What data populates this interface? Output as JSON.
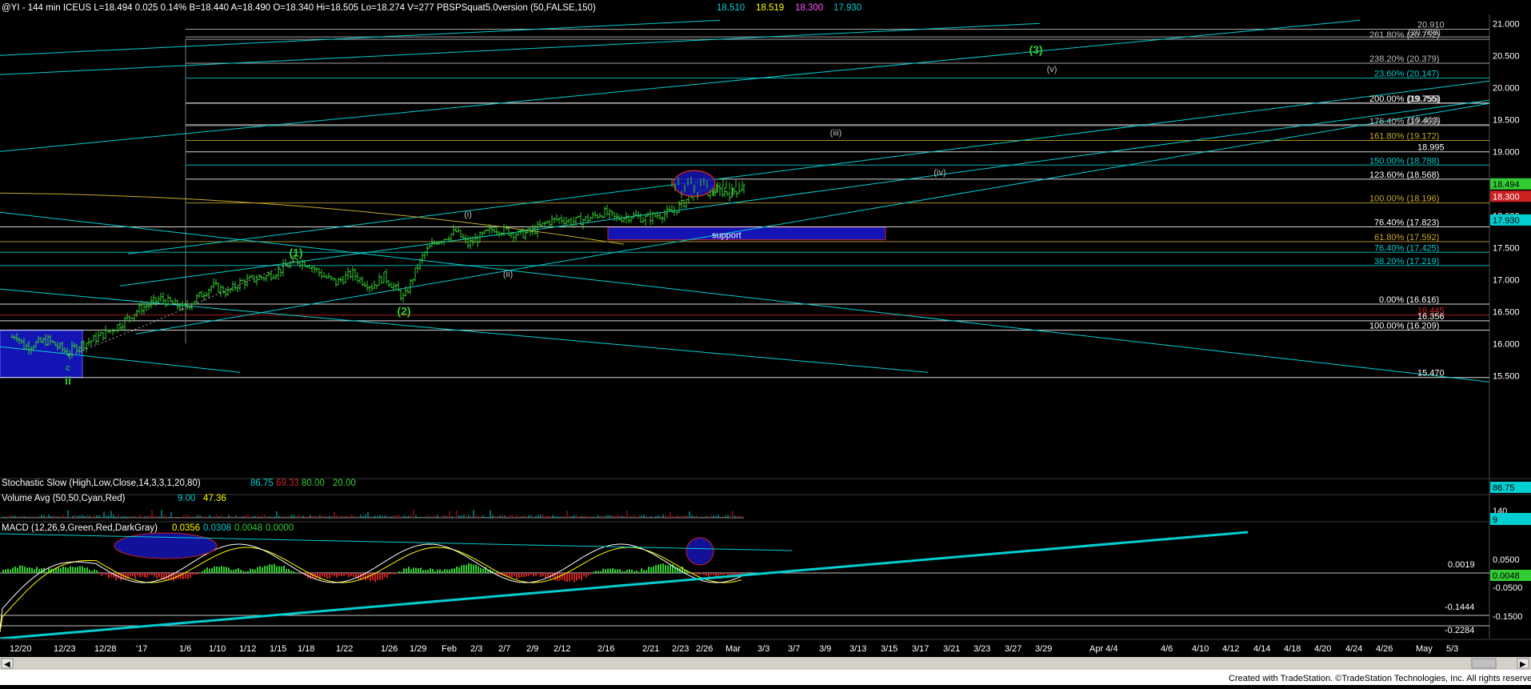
{
  "header": {
    "symbol_line": "@YI - 144 min  ICEUS  L=18.494  0.025  0.14%  B=18.440  A=18.490  O=18.340  Hi=18.505  Lo=18.274  V=277  PBSPSquat5.0version (50,FALSE,150)",
    "v1": "18.510",
    "v2": "18.519",
    "v3": "18.300",
    "v4": "17.930"
  },
  "colors": {
    "bg": "#000000",
    "cyan": "#00CED1",
    "green": "#33CC33",
    "red": "#CC2222",
    "blue": "#1414B4",
    "gold": "#C8A82A",
    "white": "#FFFFFF",
    "grey": "#BFBFBF",
    "yellow": "#FFFF00",
    "axis": "#505050"
  },
  "price_axis": [
    "21.000",
    "20.500",
    "20.000",
    "19.500",
    "19.000",
    "18.500",
    "18.000",
    "17.500",
    "17.000",
    "16.500",
    "16.000",
    "15.500"
  ],
  "levels": [
    {
      "label": "20.910",
      "price": 20.91,
      "color": "#BFBFBF"
    },
    {
      "label": "261.80% (20.752)",
      "price": 20.752,
      "color": "#BFBFBF"
    },
    {
      "label": "(20.788)",
      "price": 20.79,
      "color": "#BFBFBF"
    },
    {
      "label": "238.20% (20.379)",
      "price": 20.379,
      "color": "#BFBFBF"
    },
    {
      "label": "23.60% (20.147)",
      "price": 20.147,
      "color": "#00CED1"
    },
    {
      "label": "200.00% (19.755)",
      "price": 19.755,
      "color": "#FFFFFF"
    },
    {
      "label": "(19.755)",
      "price": 19.755,
      "color": "#FFFFFF"
    },
    {
      "label": "176.40% (19.403)",
      "price": 19.403,
      "color": "#BFBFBF"
    },
    {
      "label": "(19.403)",
      "price": 19.42,
      "color": "#BFBFBF"
    },
    {
      "label": "161.80% (19.172)",
      "price": 19.172,
      "color": "#C8A82A"
    },
    {
      "label": "18.995",
      "price": 18.995,
      "color": "#FFFFFF"
    },
    {
      "label": "150.00% (18.788)",
      "price": 18.788,
      "color": "#00CED1"
    },
    {
      "label": "123.60% (18.568)",
      "price": 18.568,
      "color": "#FFFFFF"
    },
    {
      "label": "100.00% (18.196)",
      "price": 18.196,
      "color": "#C8A82A"
    },
    {
      "label": "76.40% (17.823)",
      "price": 17.823,
      "color": "#FFFFFF"
    },
    {
      "label": "61.80% (17.592)",
      "price": 17.592,
      "color": "#C8A82A"
    },
    {
      "label": "76.40% (17.425)",
      "price": 17.425,
      "color": "#00CED1"
    },
    {
      "label": "38.20% (17.219)",
      "price": 17.219,
      "color": "#00CED1"
    },
    {
      "label": "0.00% (16.616)",
      "price": 16.616,
      "color": "#FFFFFF"
    },
    {
      "label": "16.445",
      "price": 16.445,
      "color": "#CC2222"
    },
    {
      "label": "16.356",
      "price": 16.356,
      "color": "#FFFFFF"
    },
    {
      "label": "100.00% (16.209)",
      "price": 16.209,
      "color": "#FFFFFF"
    },
    {
      "label": "15.470",
      "price": 15.47,
      "color": "#FFFFFF"
    }
  ],
  "price_badges": [
    {
      "label": "18.494",
      "price": 18.494,
      "bg": "#33CC33",
      "fg": "#000000"
    },
    {
      "label": "18.300",
      "price": 18.3,
      "bg": "#CC2222",
      "fg": "#FFFFFF"
    },
    {
      "label": "17.930",
      "price": 17.93,
      "bg": "#00CED1",
      "fg": "#000000"
    }
  ],
  "wave_labels": [
    {
      "text": "(3)",
      "date": "Mar 28",
      "price": 20.53,
      "color": "#33CC33",
      "bold": true
    },
    {
      "text": "(v)",
      "date": "Mar 29",
      "price": 20.24,
      "color": "#BFBFBF",
      "bold": false
    },
    {
      "text": "(iii)",
      "date": "Mar 10",
      "price": 19.25,
      "color": "#BFBFBF",
      "bold": false
    },
    {
      "text": "(iv)",
      "date": "Mar 20",
      "price": 18.63,
      "color": "#BFBFBF",
      "bold": false
    },
    {
      "text": "(i)",
      "date": "Feb 3",
      "price": 17.97,
      "color": "#BFBFBF",
      "bold": false
    },
    {
      "text": "(ii)",
      "date": "Feb 8",
      "price": 17.04,
      "color": "#BFBFBF",
      "bold": false
    },
    {
      "text": "(1)",
      "date": "Jan 17",
      "price": 17.36,
      "color": "#33CC33",
      "bold": true
    },
    {
      "text": "(2)",
      "date": "Jan 27",
      "price": 16.45,
      "color": "#33CC33",
      "bold": true
    },
    {
      "text": "c",
      "date": "Dec 26",
      "price": 15.58,
      "color": "#33CC33",
      "bold": false
    },
    {
      "text": "ii",
      "date": "Dec 26",
      "price": 15.36,
      "color": "#33CC33",
      "bold": true
    }
  ],
  "support_label": "support",
  "stochastic": {
    "title": "Stochastic Slow (High,Low,Close,14,3,3,1,20,80)",
    "k": "86.75",
    "d": "69.33",
    "ob": "80.00",
    "os": "20.00",
    "axis": "86.75"
  },
  "volume": {
    "title": "Volume Avg (50,50,Cyan,Red)",
    "v1": "9.00",
    "v2": "47.36",
    "axis_top": "140",
    "axis_badge": "9"
  },
  "macd": {
    "title": "MACD (12,26,9,Green,Red,DarkGray)",
    "v1": "0.0356",
    "v2": "0.0308",
    "v3": "0.0048",
    "v4": "0.0000",
    "axis": [
      "0.0500",
      "-0.0500",
      "-0.1500"
    ],
    "level_labels": [
      "0.0019",
      "-0.1444",
      "-0.2284"
    ],
    "badge": "0.0048"
  },
  "date_axis": [
    "12/20",
    "12/23",
    "12/28",
    "'17",
    "1/6",
    "1/10",
    "1/12",
    "1/15",
    "1/18",
    "1/22",
    "1/26",
    "1/29",
    "Feb",
    "2/3",
    "2/7",
    "2/9",
    "2/12",
    "2/16",
    "2/21",
    "2/23",
    "2/26",
    "Mar",
    "3/3",
    "3/7",
    "3/9",
    "3/13",
    "3/15",
    "3/17",
    "3/21",
    "3/23",
    "3/27",
    "3/29",
    "Apr 4/4",
    "4/6",
    "4/10",
    "4/12",
    "4/14",
    "4/18",
    "4/20",
    "4/24",
    "4/26",
    "May",
    "5/3"
  ],
  "footer": "Created with TradeStation. ©TradeStation Technologies, Inc. All rights reserved.",
  "chart_data": {
    "type": "candlestick",
    "title": "@YI - 144 min",
    "x": [
      "12/20",
      "12/23",
      "12/28",
      "'17",
      "1/6",
      "1/10",
      "1/12",
      "1/15",
      "1/18",
      "1/22",
      "1/26",
      "1/29",
      "Feb",
      "2/3",
      "2/7",
      "2/9",
      "2/12",
      "2/16",
      "2/21",
      "2/23",
      "2/26",
      "Mar"
    ],
    "close_approx": [
      16.1,
      15.85,
      16.0,
      16.3,
      16.6,
      16.8,
      16.9,
      17.1,
      17.2,
      17.0,
      16.8,
      16.9,
      17.6,
      17.4,
      17.75,
      17.7,
      17.85,
      18.0,
      17.95,
      18.0,
      18.35,
      18.45
    ],
    "ylim": [
      15.3,
      21.1
    ],
    "last": 18.494,
    "support_zone": [
      17.62,
      17.82
    ]
  }
}
